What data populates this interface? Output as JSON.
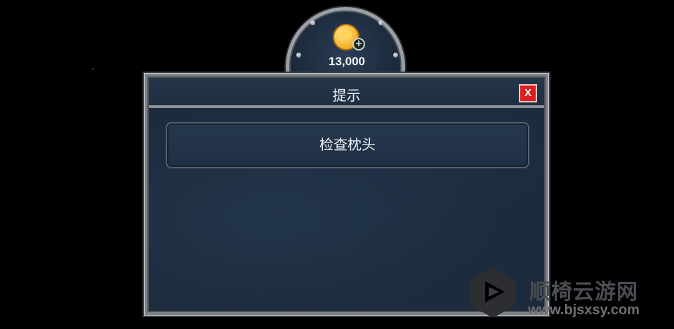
{
  "currency": {
    "amount": "13,000",
    "icon": "gold-coin-icon",
    "add_icon": "plus-icon"
  },
  "dialog": {
    "title": "提示",
    "close_label": "X",
    "option_label": "检查枕头"
  },
  "watermark": {
    "title": "顺椅云游网",
    "url": "www.bjsxsy.com"
  },
  "colors": {
    "close_red": "#d8201f",
    "panel_blue": "#1c2b3d",
    "frame_gray": "#7f8388",
    "coin_gold": "#f7b733"
  }
}
